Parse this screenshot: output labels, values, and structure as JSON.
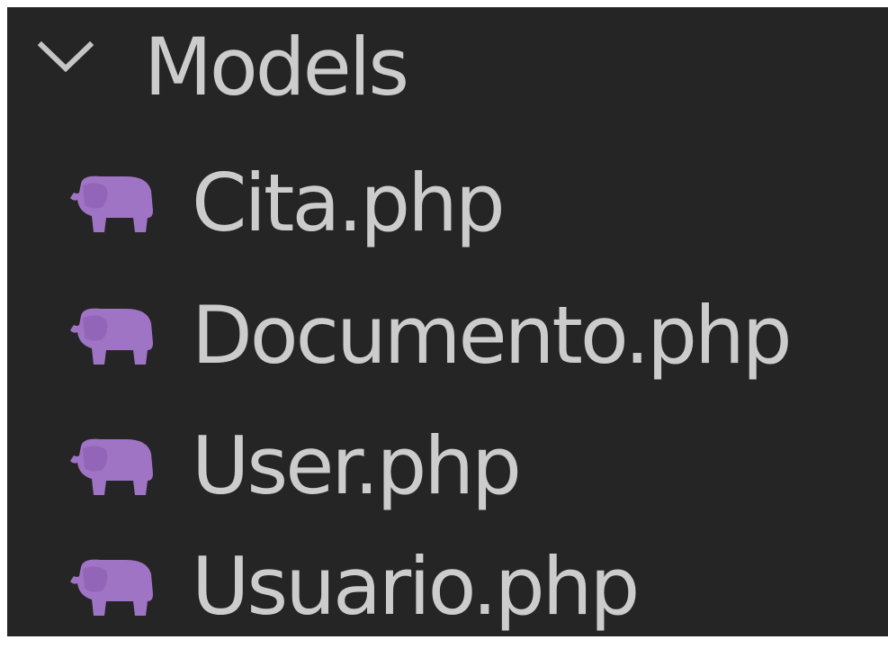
{
  "explorer": {
    "folder": {
      "label": "Models",
      "expanded": true,
      "chevron_icon": "chevron-down-icon"
    },
    "file_icon": "php-elephant-icon",
    "files": [
      {
        "label": "Cita.php"
      },
      {
        "label": "Documento.php"
      },
      {
        "label": "User.php"
      },
      {
        "label": "Usuario.php"
      }
    ]
  },
  "colors": {
    "background": "#252526",
    "text": "#cccccc",
    "php_icon": "#a074c4"
  }
}
